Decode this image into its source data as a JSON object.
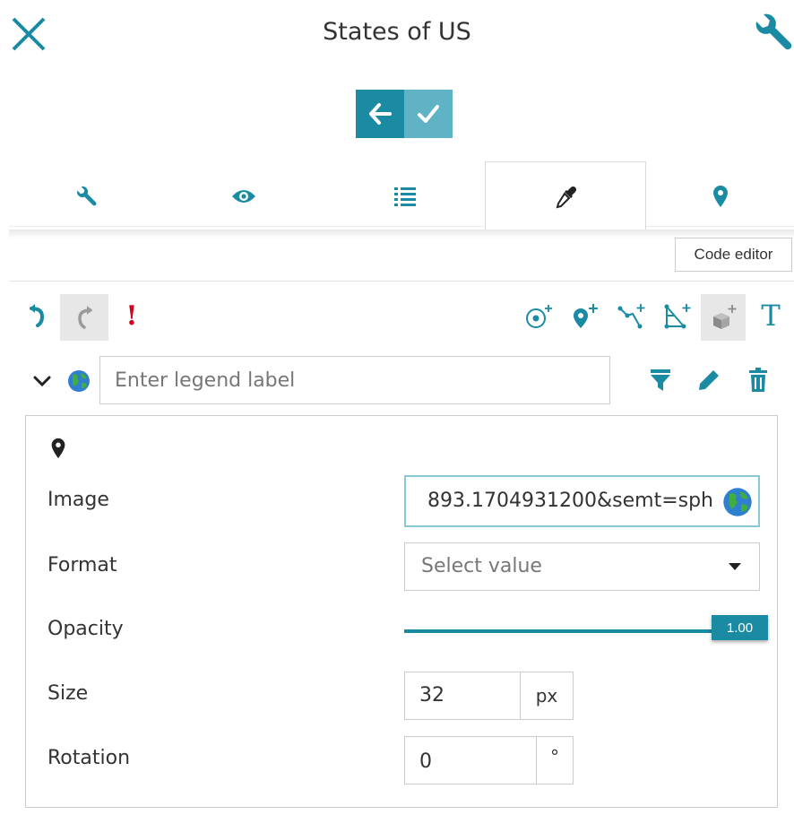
{
  "header": {
    "title": "States of US"
  },
  "tabs": [
    {
      "id": "settings",
      "icon": "wrench-icon"
    },
    {
      "id": "visibility",
      "icon": "eye-icon"
    },
    {
      "id": "legend",
      "icon": "list-icon"
    },
    {
      "id": "styles",
      "icon": "eyedropper-icon",
      "active": true
    },
    {
      "id": "features",
      "icon": "map-pin-icon"
    }
  ],
  "code_editor_label": "Code editor",
  "toolbar": {
    "left": [
      "undo-icon",
      "redo-icon",
      "warning-icon"
    ],
    "right": [
      "add-circle-icon",
      "add-point-icon",
      "add-line-icon",
      "add-polygon-icon",
      "add-3d-icon",
      "add-text-icon"
    ],
    "warning_glyph": "!",
    "text_glyph": "T"
  },
  "legend": {
    "placeholder": "Enter legend label",
    "value": ""
  },
  "style_panel": {
    "geometry_icon": "map-pin-icon",
    "image": {
      "label": "Image",
      "value": "893.1704931200&semt=sph"
    },
    "format": {
      "label": "Format",
      "placeholder": "Select value"
    },
    "opacity": {
      "label": "Opacity",
      "value": "1.00",
      "level": 1.0
    },
    "size": {
      "label": "Size",
      "value": "32",
      "unit": "px"
    },
    "rotation": {
      "label": "Rotation",
      "value": "0",
      "unit": "°"
    }
  },
  "colors": {
    "accent": "#1a8ba3",
    "accent_light": "#5fb3c4",
    "warning": "#d0021b",
    "text": "#333333"
  }
}
